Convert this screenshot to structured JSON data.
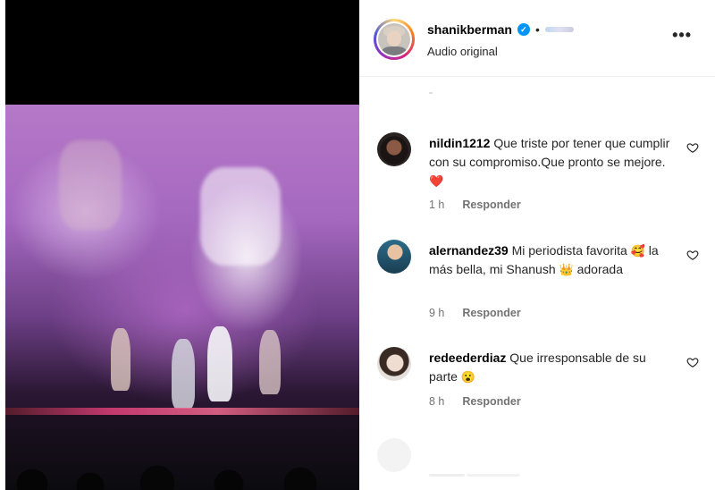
{
  "post": {
    "username": "shanikberman",
    "separator": "•",
    "audio_label": "Audio original",
    "more_label": "•••"
  },
  "comments": [
    {
      "username": "nildin1212",
      "text": "Que triste por tener que cumplir con su compromiso.Que pronto se mejore.",
      "emoji": "❤️",
      "time": "1 h",
      "reply_label": "Responder"
    },
    {
      "username": "alernandez39",
      "text_before": "Mi periodista favorita",
      "emoji1": "🥰",
      "text_middle": "la más bella, mi Shanush",
      "emoji2": "👑",
      "text_after": "adorada",
      "time": "9 h",
      "reply_label": "Responder"
    },
    {
      "username": "redeederdiaz",
      "text": "Que irresponsable de su parte",
      "emoji": "😮",
      "time": "8 h",
      "reply_label": "Responder"
    }
  ],
  "icons": {
    "verified": "verified-badge-icon",
    "heart": "heart-outline-icon",
    "more": "more-options-icon"
  },
  "colors": {
    "verified_blue": "#0095f6",
    "meta_gray": "#737373",
    "heart_red": "#e0245e"
  }
}
